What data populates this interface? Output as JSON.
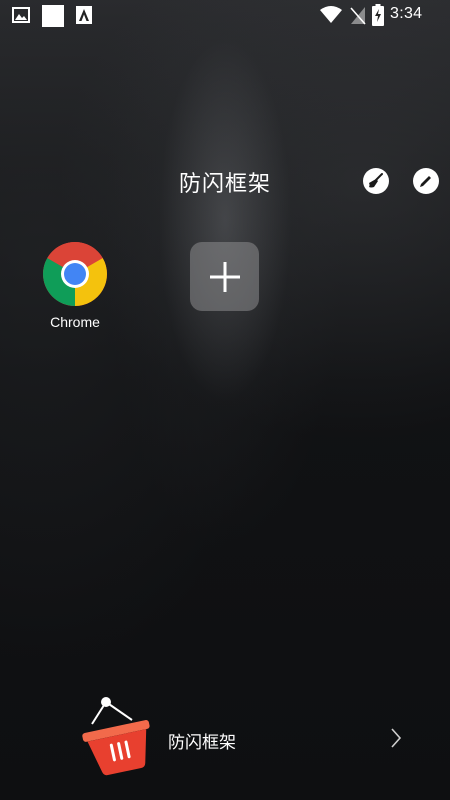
{
  "status_bar": {
    "time": "3:34",
    "icons": [
      "image-icon",
      "white-square",
      "a-icon",
      "wifi-icon",
      "signal-off-icon",
      "battery-charging-icon"
    ]
  },
  "folder": {
    "title": "防闪框架",
    "actions": [
      "broom-icon",
      "pencil-icon"
    ]
  },
  "apps": [
    {
      "label": "Chrome",
      "icon": "chrome-icon"
    }
  ],
  "add_tile": {
    "icon": "plus-icon"
  },
  "banner": {
    "text": "防闪框架",
    "icon": "shopping-basket-icon",
    "arrow": "chevron-right-icon"
  },
  "colors": {
    "basket_red": "#e8402f",
    "tile_gray": "#8c8c8e",
    "chrome_red": "#db4437",
    "chrome_yellow": "#f4c20d",
    "chrome_green": "#0f9d58",
    "chrome_blue": "#4285f4"
  }
}
